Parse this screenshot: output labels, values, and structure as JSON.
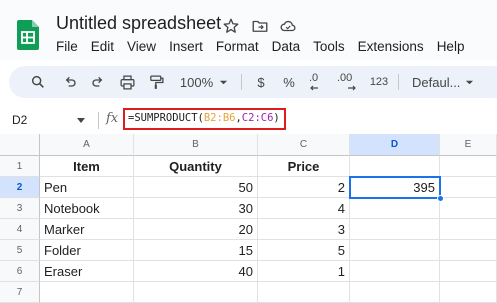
{
  "app": {
    "title": "Untitled spreadsheet",
    "menu": [
      "File",
      "Edit",
      "View",
      "Insert",
      "Format",
      "Data",
      "Tools",
      "Extensions",
      "Help"
    ]
  },
  "toolbar": {
    "zoom": "100%",
    "currency_label": "$",
    "percent_label": "%",
    "decrease_decimal_label": ".0",
    "increase_decimal_label": ".00",
    "number_format_label": "123",
    "font_label": "Defaul..."
  },
  "formula_bar": {
    "name_box": "D2",
    "fx": "fx",
    "formula_prefix": "=SUMPRODUCT(",
    "formula_ref1": "B2:B6",
    "formula_sep": ",",
    "formula_ref2": "C2:C6",
    "formula_suffix": ")"
  },
  "sheet": {
    "columns": [
      "A",
      "B",
      "C",
      "D",
      "E"
    ],
    "rows": [
      "1",
      "2",
      "3",
      "4",
      "5",
      "6",
      "7"
    ],
    "header": {
      "a": "Item",
      "b": "Quantity",
      "c": "Price"
    },
    "data": [
      {
        "item": "Pen",
        "quantity": "50",
        "price": "2",
        "total": "395"
      },
      {
        "item": "Notebook",
        "quantity": "30",
        "price": "4",
        "total": ""
      },
      {
        "item": "Marker",
        "quantity": "20",
        "price": "3",
        "total": ""
      },
      {
        "item": "Folder",
        "quantity": "15",
        "price": "5",
        "total": ""
      },
      {
        "item": "Eraser",
        "quantity": "40",
        "price": "1",
        "total": ""
      }
    ],
    "selected_cell": "D2"
  },
  "colors": {
    "accent": "#1a73e8",
    "highlight_border": "#dd1d1d",
    "sheets_green": "#0f9d58",
    "ref1": "#e8a33a",
    "ref2": "#9c27b0"
  }
}
